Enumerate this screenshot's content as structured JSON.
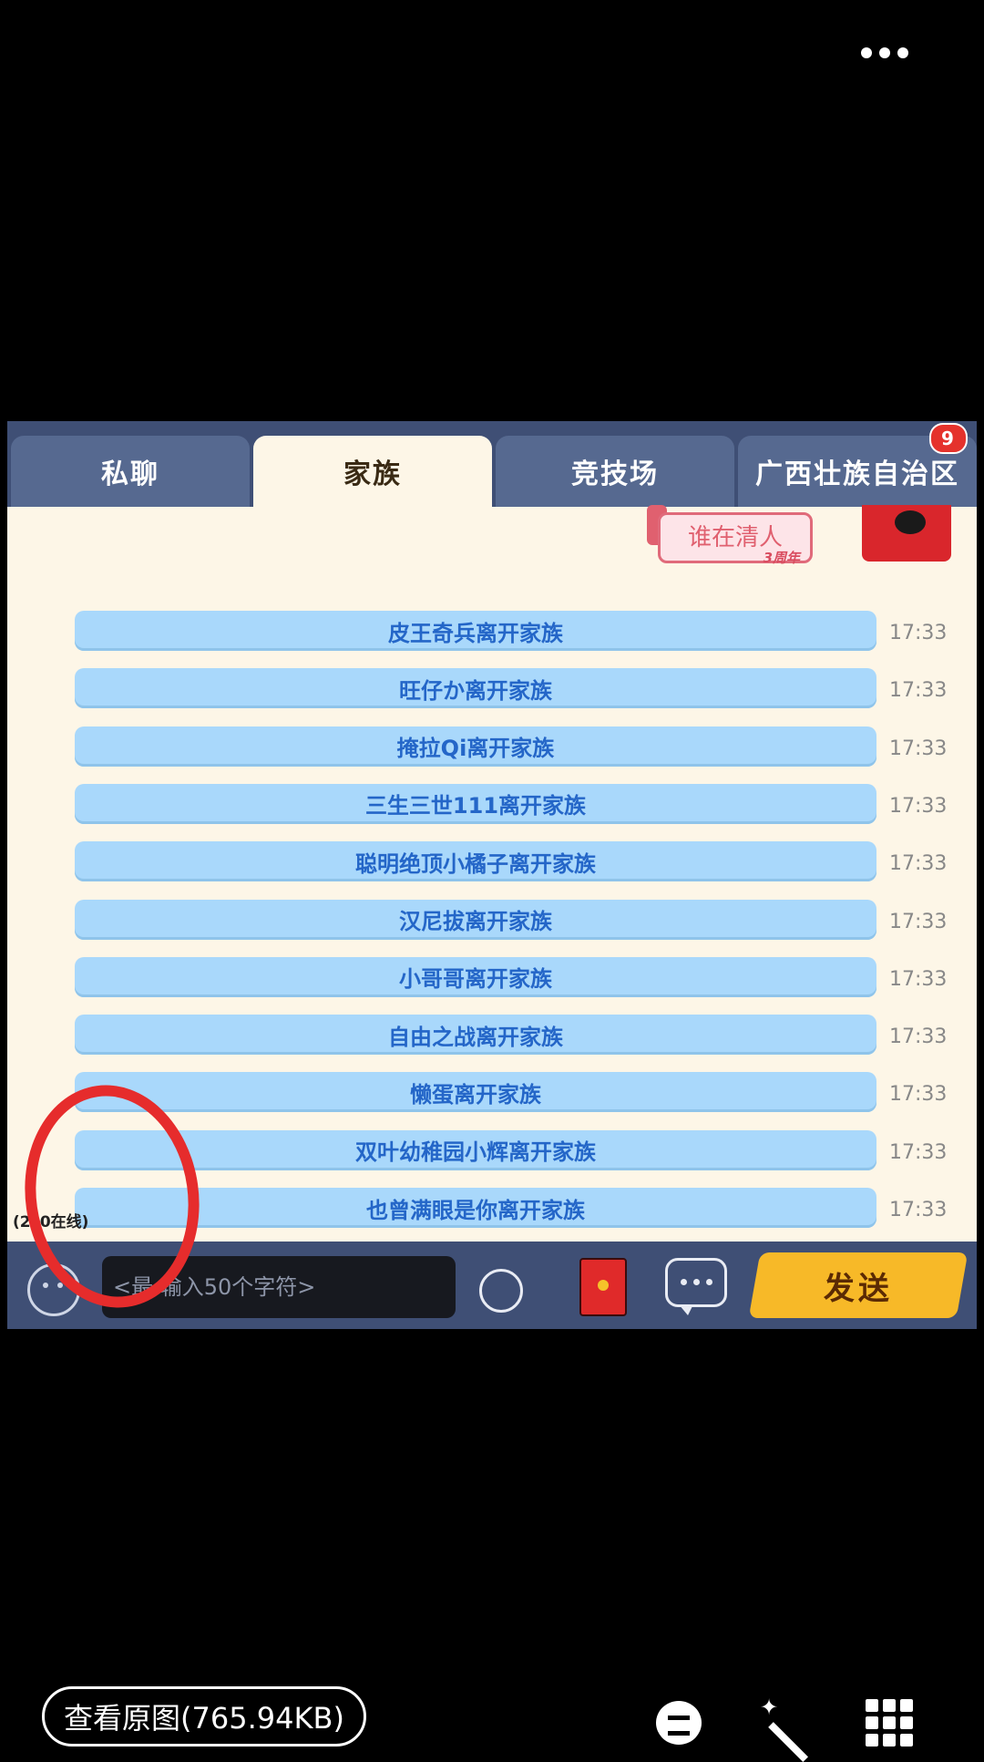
{
  "tabs": [
    {
      "label": "私聊"
    },
    {
      "label": "家族"
    },
    {
      "label": "竞技场"
    },
    {
      "label": "广西壮族自治区",
      "badge": "9"
    }
  ],
  "notice": {
    "title": "谁在清人",
    "sub": "3周年"
  },
  "messages": [
    {
      "text": "皮王奇兵离开家族",
      "time": "17:33"
    },
    {
      "text": "旺仔か离开家族",
      "time": "17:33"
    },
    {
      "text": "掩拉Qi离开家族",
      "time": "17:33"
    },
    {
      "text": "三生三世111离开家族",
      "time": "17:33"
    },
    {
      "text": "聪明绝顶小橘子离开家族",
      "time": "17:33"
    },
    {
      "text": "汉尼拔离开家族",
      "time": "17:33"
    },
    {
      "text": "小哥哥离开家族",
      "time": "17:33"
    },
    {
      "text": "自由之战离开家族",
      "time": "17:33"
    },
    {
      "text": "懒蛋离开家族",
      "time": "17:33"
    },
    {
      "text": "双叶幼稚园小辉离开家族",
      "time": "17:33"
    },
    {
      "text": "也曾满眼是你离开家族",
      "time": "17:33"
    }
  ],
  "online_count": "(2─0在线)",
  "input": {
    "placeholder": "<最 输入50个字符>"
  },
  "send_label": "发送",
  "view_original_label": "查看原图(765.94KB)",
  "colors": {
    "annotation": "#e62c2c",
    "send": "#f7b928",
    "tab_bar": "#3f4f75",
    "message_bg": "#a9d8fb"
  }
}
